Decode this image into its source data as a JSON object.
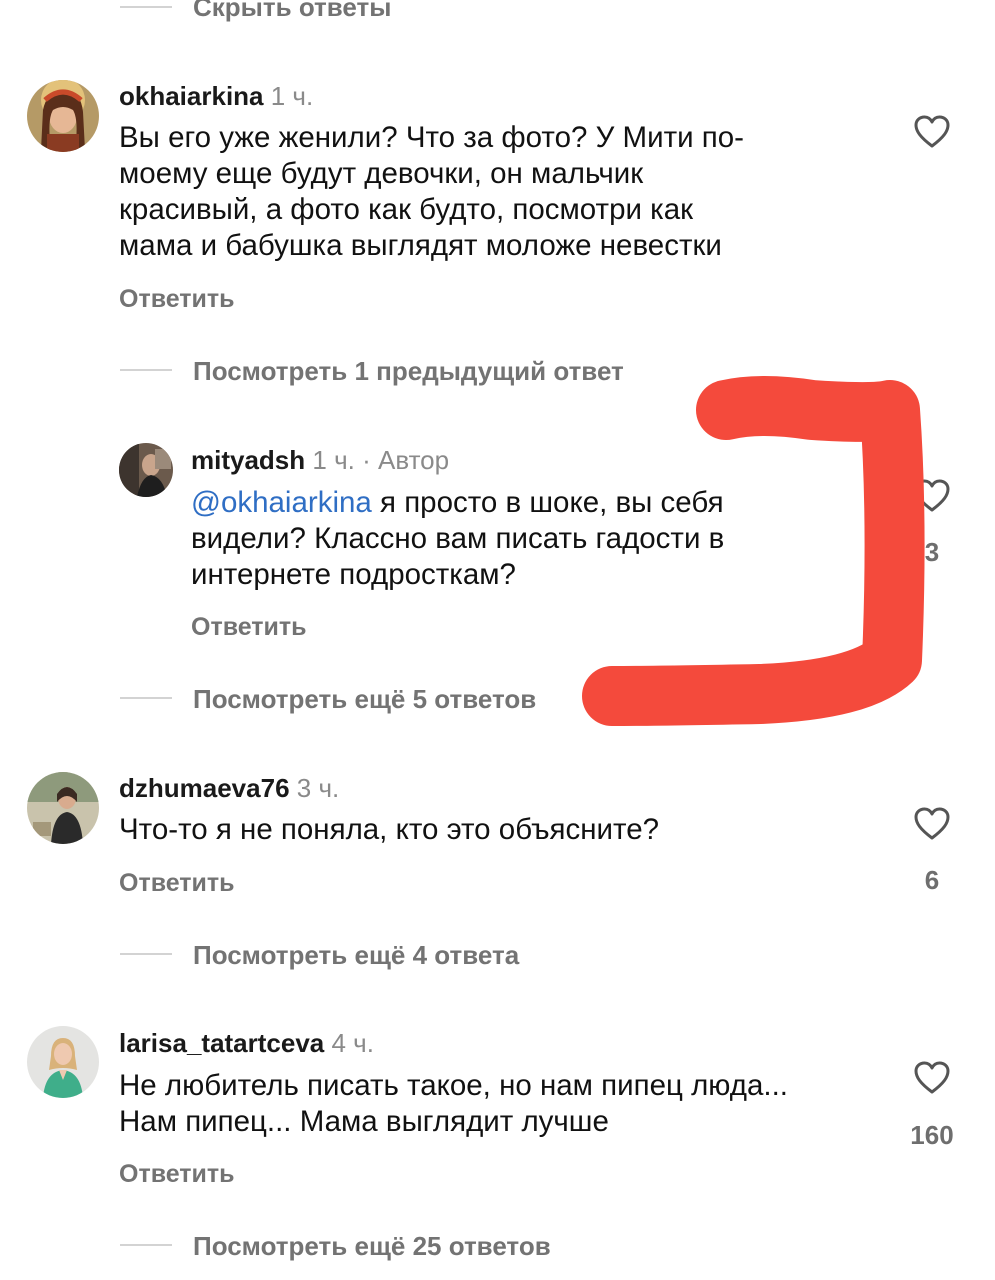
{
  "top_link": "Скрыть ответы",
  "comments": [
    {
      "username": "okhaiarkina",
      "time": "1 ч.",
      "lines": [
        "Вы его уже женили? Что за фото? У Мити по-",
        "моему еще будут девочки, он мальчик",
        "красивый,  а фото как будто,  посмотри как",
        "мама и бабушка выглядят моложе невестки"
      ],
      "reply_label": "Ответить",
      "thread_link": "Посмотреть 1 предыдущий ответ"
    },
    {
      "username": "mityadsh",
      "time": "1 ч.",
      "separator": "·",
      "author_badge": "Автор",
      "mention": "@okhaiarkina",
      "lines": [
        " я просто в шоке, вы себя",
        "видели? Классно вам писать гадости в",
        "интернете подросткам?"
      ],
      "reply_label": "Ответить",
      "likes": "3",
      "thread_link": "Посмотреть ещё 5 ответов"
    },
    {
      "username": "dzhumaeva76",
      "time": "3 ч.",
      "lines": [
        "Что-то я не поняла, кто это объясните?"
      ],
      "reply_label": "Ответить",
      "likes": "6",
      "thread_link": "Посмотреть ещё 4 ответа"
    },
    {
      "username": "larisa_tatartceva",
      "time": "4 ч.",
      "lines": [
        "Не любитель писать такое, но нам пипец люда...",
        "Нам пипец... Мама выглядит лучше"
      ],
      "reply_label": "Ответить",
      "likes": "160",
      "thread_link": "Посмотреть ещё 25 ответов"
    }
  ],
  "colors": {
    "meta_gray": "#8a8a8a",
    "mention_blue": "#2f6ec4",
    "annotation_red": "#f44a3c"
  },
  "icons": [
    "heart-outline-icon"
  ]
}
